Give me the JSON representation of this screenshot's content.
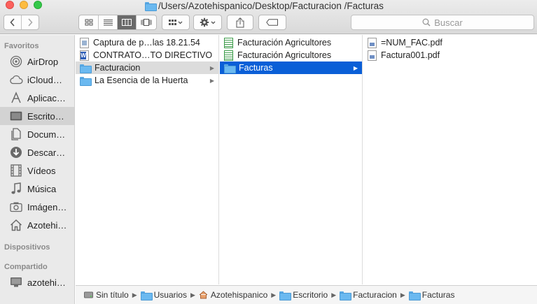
{
  "window": {
    "title": "/Users/Azotehispanico/Desktop/Facturacion /Facturas"
  },
  "toolbar": {
    "back_icon": "chevron-left",
    "forward_icon": "chevron-right",
    "views": [
      "icon-view",
      "list-view",
      "column-view",
      "cover-flow-view"
    ],
    "active_view": "column-view",
    "search_placeholder": "Buscar"
  },
  "sidebar": {
    "sections": [
      {
        "title": "Favoritos",
        "items": [
          {
            "label": "AirDrop",
            "icon": "airdrop"
          },
          {
            "label": "iCloud…",
            "icon": "cloud"
          },
          {
            "label": "Aplicac…",
            "icon": "applications"
          },
          {
            "label": "Escrito…",
            "icon": "desktop",
            "selected": true
          },
          {
            "label": "Docum…",
            "icon": "documents"
          },
          {
            "label": "Descar…",
            "icon": "downloads"
          },
          {
            "label": "Vídeos",
            "icon": "movies"
          },
          {
            "label": "Música",
            "icon": "music"
          },
          {
            "label": "Imágen…",
            "icon": "pictures"
          },
          {
            "label": "Azotehi…",
            "icon": "home"
          }
        ]
      },
      {
        "title": "Dispositivos",
        "items": []
      },
      {
        "title": "Compartido",
        "items": [
          {
            "label": "azotehi…",
            "icon": "computer"
          }
        ]
      }
    ]
  },
  "columns": [
    {
      "items": [
        {
          "name": "Captura de p…las 18.21.54",
          "kind": "image"
        },
        {
          "name": "CONTRATO…TO DIRECTIVO",
          "kind": "word"
        },
        {
          "name": "Facturacion",
          "kind": "folder",
          "selected": "gray"
        },
        {
          "name": "La Esencia de la Huerta",
          "kind": "folder"
        }
      ]
    },
    {
      "items": [
        {
          "name": "Facturación Agricultores",
          "kind": "sheet"
        },
        {
          "name": "Facturación Agricultores",
          "kind": "sheet"
        },
        {
          "name": "Facturas",
          "kind": "folder",
          "selected": "blue"
        }
      ]
    },
    {
      "items": [
        {
          "name": "=NUM_FAC.pdf",
          "kind": "pdf"
        },
        {
          "name": "Factura001.pdf",
          "kind": "pdf"
        }
      ]
    }
  ],
  "pathbar": [
    {
      "label": "Sin título",
      "icon": "disk"
    },
    {
      "label": "Usuarios",
      "icon": "folder"
    },
    {
      "label": "Azotehispanico",
      "icon": "home"
    },
    {
      "label": "Escritorio",
      "icon": "folder"
    },
    {
      "label": "Facturacion",
      "icon": "folder"
    },
    {
      "label": "Facturas",
      "icon": "folder"
    }
  ]
}
